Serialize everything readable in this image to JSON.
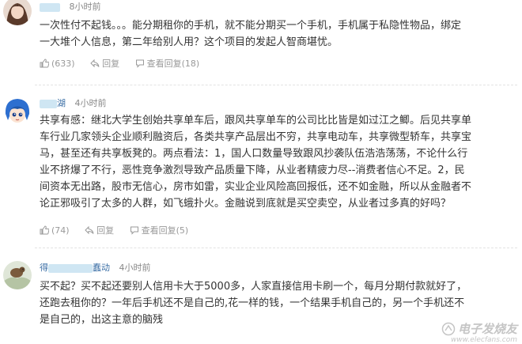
{
  "comments": [
    {
      "username_visible": "",
      "username_suffix": "",
      "time": "8小时前",
      "lines": [
        "一次性付不起钱。。。能分期租你的手机，就不能分期买一个手机，手机属于私隐性物品，绑定",
        "一大堆个人信息，第二年给别人用？这个项目的发起人智商堪忧。"
      ],
      "likes": "(633)",
      "reply_label": "回复",
      "view_replies_label": "查看回复(18)"
    },
    {
      "username_visible": "",
      "username_suffix": "湖",
      "time": "4小时前",
      "lines": [
        "共享有感：继北大学生创始共享单车后，跟风共享单车的公司比比皆是如过江之鲫。后见共享单",
        "车行业几家领头企业顺利融资后，各类共享产品层出不穷，共享电动车，共享微型轿车，共享宝",
        "马，甚至还有共享板凳的。两点看法：1，国人口数量导致跟风抄袭队伍浩浩荡荡，不论什么行",
        "业不挤爆了不行，恶性竞争激烈导致产品质量下降，从业者精疲力尽--消费者信心不足。2，民",
        "间资本无出路，股市无信心，房市如雷，实业企业风险高回报低，还不如金融，所以从金融者不",
        "论正邪吸引了太多的人群，如飞蛾扑火。金融说到底就是买空卖空，从业者过多真的好吗？"
      ],
      "likes": "(74)",
      "reply_label": "回复",
      "view_replies_label": "查看回复(5)"
    },
    {
      "username_visible": "得",
      "username_suffix": "蠢动",
      "time": "4小时前",
      "lines": [
        "买不起？买不起还要别人信用卡大于5000多，人家直接信用卡刷一个，每月分期付款就好了，",
        "还跑去租你的？一年后手机还不是自己的,花一样的钱，一个结果手机自己的，另一个手机还不",
        "是自己的，出这主意的脑残"
      ]
    }
  ],
  "icons": {
    "like": "thumbs-up-icon",
    "reply": "reply-arrow-icon",
    "view_replies": "speech-bubble-icon"
  },
  "watermark": {
    "brand": "电子发烧友",
    "url": "www.elecfans.com"
  },
  "colors": {
    "text": "#333333",
    "meta": "#888888",
    "username": "#3a6ea5",
    "actions": "#999999"
  }
}
